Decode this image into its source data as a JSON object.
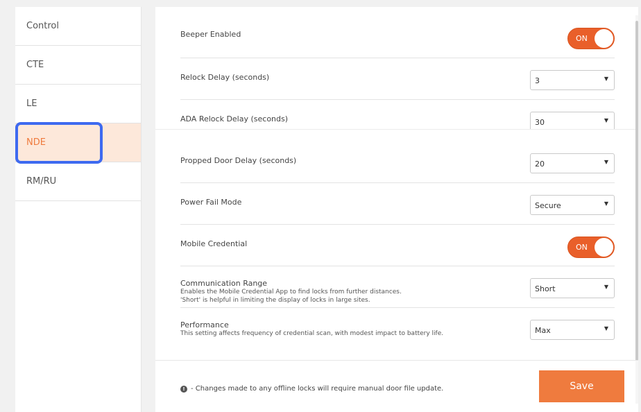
{
  "sidebar": {
    "items": [
      {
        "label": "Control"
      },
      {
        "label": "CTE"
      },
      {
        "label": "LE"
      },
      {
        "label": "NDE"
      },
      {
        "label": "RM/RU"
      }
    ]
  },
  "settings": {
    "beeper": {
      "label": "Beeper Enabled",
      "toggle": "ON"
    },
    "relock": {
      "label": "Relock Delay (seconds)",
      "value": "3"
    },
    "ada_relock": {
      "label": "ADA Relock Delay (seconds)",
      "value": "30"
    },
    "propped": {
      "label": "Propped Door Delay (seconds)",
      "value": "20"
    },
    "power_fail": {
      "label": "Power Fail Mode",
      "value": "Secure"
    },
    "mobile": {
      "label": "Mobile Credential",
      "toggle": "ON"
    },
    "comm_range": {
      "label": "Communication Range",
      "desc1": "Enables the Mobile Credential App to find locks from further distances.",
      "desc2": "'Short' is helpful in limiting the display of locks in large sites.",
      "value": "Short"
    },
    "performance": {
      "label": "Performance",
      "desc1": "This setting affects frequency of credential scan, with modest impact to battery life.",
      "value": "Max"
    }
  },
  "footer": {
    "note": "- Changes made to any offline locks will require manual door file update.",
    "save_label": "Save"
  },
  "colors": {
    "accent": "#ef7b3e",
    "active_bg": "#fde8da",
    "highlight": "#3e6af0"
  }
}
